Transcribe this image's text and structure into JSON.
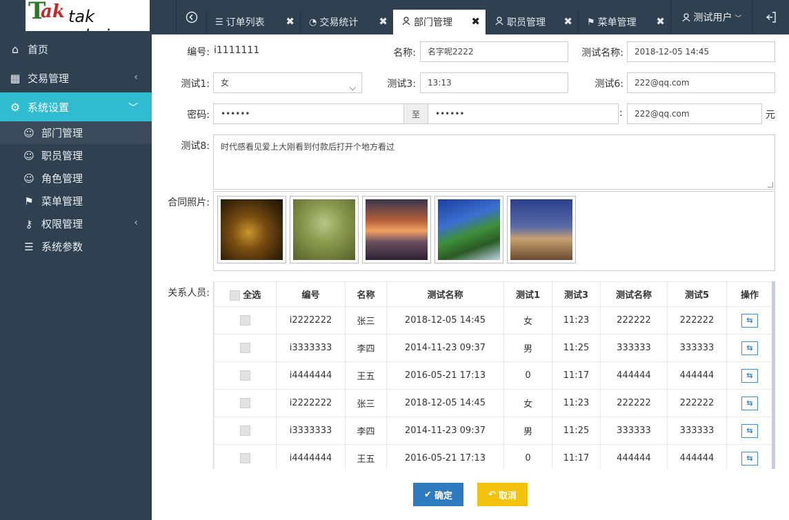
{
  "logo": {
    "mark": "T",
    "mark2": "ak",
    "brand": "tak admin"
  },
  "header": {
    "back_icon": "back-circle-icon",
    "tabs": [
      {
        "label": "订单列表",
        "icon": "list-icon"
      },
      {
        "label": "交易统计",
        "icon": "pie-icon"
      },
      {
        "label": "部门管理",
        "icon": "users-icon"
      },
      {
        "label": "职员管理",
        "icon": "user-tie-icon"
      },
      {
        "label": "菜单管理",
        "icon": "sign-icon"
      }
    ],
    "user": "测试用户",
    "logout_icon": "logout-icon"
  },
  "sidebar": {
    "items": [
      {
        "label": "首页",
        "icon": "home-icon"
      },
      {
        "label": "交易管理",
        "icon": "calendar-icon"
      },
      {
        "label": "系统设置",
        "icon": "gear-icon"
      }
    ],
    "sub_items": [
      {
        "label": "部门管理",
        "icon": "users-icon"
      },
      {
        "label": "职员管理",
        "icon": "user-tie-icon"
      },
      {
        "label": "角色管理",
        "icon": "user-icon"
      },
      {
        "label": "菜单管理",
        "icon": "sign-icon"
      },
      {
        "label": "权限管理",
        "icon": "key-icon"
      },
      {
        "label": "系统参数",
        "icon": "sliders-icon"
      }
    ]
  },
  "form": {
    "id_label": "编号:",
    "id_value": "i1111111",
    "name_label": "名称:",
    "name_value": "名字呢2222",
    "test_name_label": "测试名称:",
    "test_name_value": "2018-12-05 14:45",
    "test1_label": "测试1:",
    "test1_value": "女",
    "test3_label": "测试3:",
    "test3_value": "13:13",
    "test6_label": "测试6:",
    "test6_value": "222@qq.com",
    "password_label": "密码:",
    "password_value": "••••••",
    "password_to": "至",
    "password_value2": "••••••",
    "colon": ":",
    "amount_value": "222@qq.com",
    "amount_unit": "元",
    "test8_label": "测试8:",
    "test8_value": "时代感看见爱上大刚看到付款后打开个地方看过",
    "photos_label": "合同照片:",
    "relations_label": "关系人员:"
  },
  "table": {
    "select_all": "全选",
    "headers": [
      "编号",
      "名称",
      "测试名称",
      "测试1",
      "测试3",
      "测试名称",
      "测试5",
      "操作"
    ],
    "rows": [
      [
        "i2222222",
        "张三",
        "2018-12-05 14:45",
        "女",
        "11:23",
        "222222",
        "222222"
      ],
      [
        "i3333333",
        "李四",
        "2014-11-23 09:37",
        "男",
        "11:25",
        "333333",
        "333333"
      ],
      [
        "i4444444",
        "王五",
        "2016-05-21 17:13",
        "0",
        "11:17",
        "444444",
        "444444"
      ],
      [
        "i2222222",
        "张三",
        "2018-12-05 14:45",
        "女",
        "11:23",
        "222222",
        "222222"
      ],
      [
        "i3333333",
        "李四",
        "2014-11-23 09:37",
        "男",
        "11:25",
        "333333",
        "333333"
      ],
      [
        "i4444444",
        "王五",
        "2016-05-21 17:13",
        "0",
        "11:17",
        "444444",
        "444444"
      ]
    ]
  },
  "buttons": {
    "confirm": "确定",
    "cancel": "取消"
  },
  "colors": {
    "sidebar_bg": "#2f4050",
    "active_menu": "#2fbcd0",
    "confirm_bg": "#2f7bbf",
    "cancel_bg": "#f2c20d"
  }
}
